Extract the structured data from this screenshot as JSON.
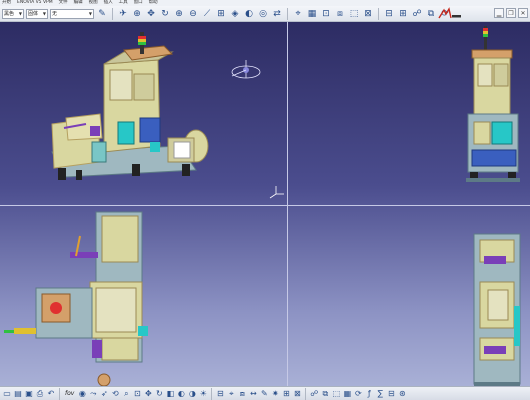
{
  "menu": [
    "开始",
    "ENOVIA V5 VPM",
    "文件",
    "编辑",
    "视图",
    "插入",
    "工具",
    "窗口",
    "帮助"
  ],
  "toolbar": {
    "combo1": "黑色",
    "combo2": "固体",
    "combo3": "无"
  },
  "statusbar": {
    "label": "fov"
  },
  "colors": {
    "viewport_top": "#2d2c63",
    "viewport_bottom": "#a9b0d6",
    "frame": "#9fb8c0",
    "panel": "#d9d7a0",
    "accent_purple": "#7a3fb8",
    "accent_cyan": "#27c7c7"
  }
}
